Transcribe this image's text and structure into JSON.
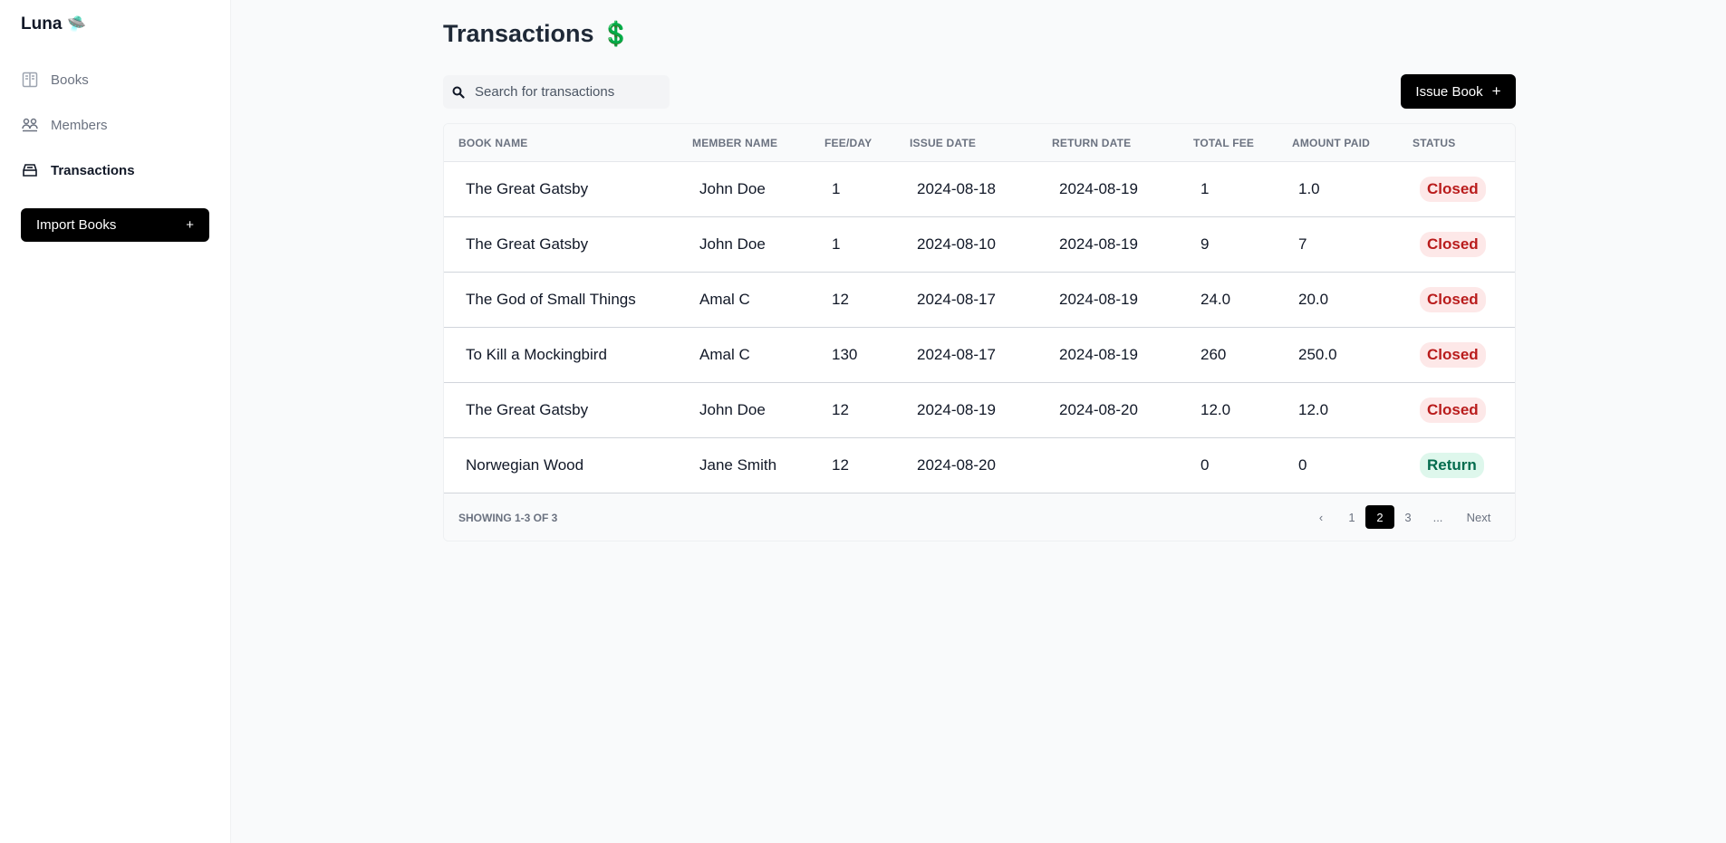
{
  "sidebar": {
    "brand": "Luna",
    "brand_icon": "ufo-emoji",
    "items": [
      {
        "label": "Books",
        "icon": "book-icon",
        "active": false
      },
      {
        "label": "Members",
        "icon": "members-icon",
        "active": false
      },
      {
        "label": "Transactions",
        "icon": "inbox-icon",
        "active": true
      }
    ],
    "import_label": "Import Books",
    "import_icon": "+"
  },
  "header": {
    "title": "Transactions",
    "title_icon": "💲"
  },
  "search": {
    "placeholder": "Search for transactions",
    "value": ""
  },
  "issue_button": {
    "label": "Issue Book",
    "icon": "+"
  },
  "table": {
    "columns": [
      "BOOK NAME",
      "MEMBER NAME",
      "FEE/DAY",
      "ISSUE DATE",
      "RETURN DATE",
      "TOTAL FEE",
      "AMOUNT PAID",
      "STATUS"
    ],
    "rows": [
      {
        "book": "The Great Gatsby",
        "member": "John Doe",
        "fee": "1",
        "issue": "2024-08-18",
        "return": "2024-08-19",
        "total": "1",
        "paid": "1.0",
        "status": "Closed"
      },
      {
        "book": "The Great Gatsby",
        "member": "John Doe",
        "fee": "1",
        "issue": "2024-08-10",
        "return": "2024-08-19",
        "total": "9",
        "paid": "7",
        "status": "Closed"
      },
      {
        "book": "The God of Small Things",
        "member": "Amal C",
        "fee": "12",
        "issue": "2024-08-17",
        "return": "2024-08-19",
        "total": "24.0",
        "paid": "20.0",
        "status": "Closed"
      },
      {
        "book": "To Kill a Mockingbird",
        "member": "Amal C",
        "fee": "130",
        "issue": "2024-08-17",
        "return": "2024-08-19",
        "total": "260",
        "paid": "250.0",
        "status": "Closed"
      },
      {
        "book": "The Great Gatsby",
        "member": "John Doe",
        "fee": "12",
        "issue": "2024-08-19",
        "return": "2024-08-20",
        "total": "12.0",
        "paid": "12.0",
        "status": "Closed"
      },
      {
        "book": "Norwegian Wood",
        "member": "Jane Smith",
        "fee": "12",
        "issue": "2024-08-20",
        "return": "",
        "total": "0",
        "paid": "0",
        "status": "Return"
      }
    ]
  },
  "footer": {
    "showing": "SHOWING 1-3 OF 3",
    "pages": [
      "‹",
      "1",
      "2",
      "3",
      "...",
      "Next"
    ],
    "current_page": "2"
  },
  "colors": {
    "closed_bg": "#fde8e8",
    "closed_text": "#b91c1c",
    "return_bg": "#def7ec",
    "return_text": "#046c4e",
    "accent": "#000000"
  }
}
